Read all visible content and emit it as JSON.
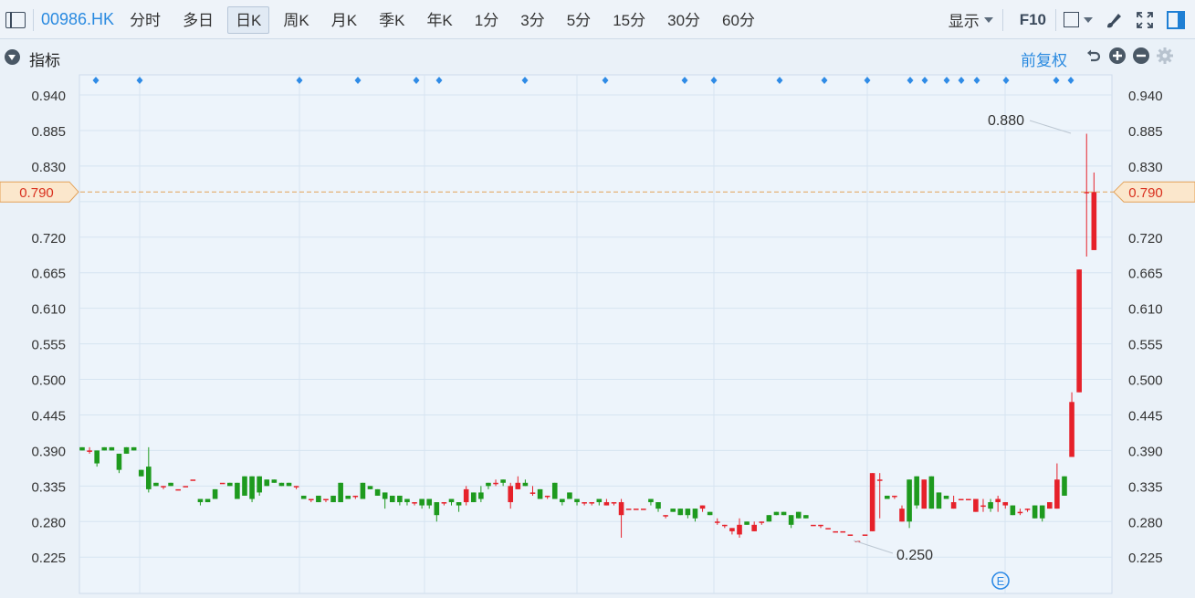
{
  "toolbar": {
    "symbol": "00986.HK",
    "periods": [
      "分时",
      "多日",
      "日K",
      "周K",
      "月K",
      "季K",
      "年K",
      "1分",
      "3分",
      "5分",
      "15分",
      "30分",
      "60分"
    ],
    "active_period": "日K",
    "display_label": "显示",
    "f10_label": "F10"
  },
  "indicator": {
    "title": "指标",
    "adjust_label": "前复权"
  },
  "icons": [
    "sidebar-toggle-icon",
    "square-icon",
    "brush-icon",
    "expand-icon",
    "panel-icon",
    "undo-icon",
    "plus-circle-icon",
    "minus-circle-icon",
    "gear-icon",
    "event-e-icon"
  ],
  "colors": {
    "up": "#e6212a",
    "down": "#1e9a1e",
    "price_line": "#e3a158",
    "price_text": "#d9301e",
    "marker": "#2f8be6",
    "grid": "#d6e4f1"
  },
  "chart_data": {
    "type": "candlestick",
    "ylim": [
      0.19,
      0.98
    ],
    "y_ticks": [
      0.94,
      0.885,
      0.83,
      0.775,
      0.72,
      0.665,
      0.61,
      0.555,
      0.5,
      0.445,
      0.39,
      0.335,
      0.28,
      0.225
    ],
    "y_tick_labels": [
      "0.940",
      "0.885",
      "0.830",
      "",
      "0.720",
      "0.665",
      "0.610",
      "0.555",
      "0.500",
      "0.445",
      "0.390",
      "0.335",
      "0.280",
      "0.225"
    ],
    "current_price": 0.79,
    "current_price_label": "0.790",
    "max_label": "0.880",
    "min_label": "0.250",
    "event_label": "E",
    "candles": [
      [
        0.395,
        0.395,
        0.39,
        0.39
      ],
      [
        0.39,
        0.395,
        0.385,
        0.39
      ],
      [
        0.39,
        0.39,
        0.365,
        0.37
      ],
      [
        0.395,
        0.395,
        0.39,
        0.39
      ],
      [
        0.395,
        0.395,
        0.39,
        0.39
      ],
      [
        0.385,
        0.385,
        0.355,
        0.36
      ],
      [
        0.395,
        0.395,
        0.385,
        0.385
      ],
      [
        0.395,
        0.395,
        0.39,
        0.39
      ],
      [
        0.36,
        0.36,
        0.35,
        0.35
      ],
      [
        0.365,
        0.395,
        0.325,
        0.33
      ],
      [
        0.34,
        0.34,
        0.335,
        0.335
      ],
      [
        0.335,
        0.335,
        0.33,
        0.335
      ],
      [
        0.34,
        0.34,
        0.335,
        0.335
      ],
      [
        0.33,
        0.33,
        0.33,
        0.33
      ],
      [
        0.335,
        0.335,
        0.335,
        0.335
      ],
      [
        0.345,
        0.345,
        0.345,
        0.345
      ],
      [
        0.315,
        0.315,
        0.305,
        0.31
      ],
      [
        0.315,
        0.315,
        0.31,
        0.31
      ],
      [
        0.33,
        0.33,
        0.315,
        0.315
      ],
      [
        0.34,
        0.34,
        0.34,
        0.34
      ],
      [
        0.34,
        0.34,
        0.335,
        0.335
      ],
      [
        0.34,
        0.34,
        0.315,
        0.315
      ],
      [
        0.35,
        0.35,
        0.32,
        0.32
      ],
      [
        0.35,
        0.35,
        0.31,
        0.315
      ],
      [
        0.35,
        0.35,
        0.32,
        0.325
      ],
      [
        0.345,
        0.345,
        0.335,
        0.335
      ],
      [
        0.345,
        0.345,
        0.34,
        0.34
      ],
      [
        0.34,
        0.34,
        0.335,
        0.335
      ],
      [
        0.34,
        0.34,
        0.335,
        0.335
      ],
      [
        0.335,
        0.335,
        0.33,
        0.335
      ],
      [
        0.32,
        0.32,
        0.315,
        0.315
      ],
      [
        0.315,
        0.315,
        0.31,
        0.315
      ],
      [
        0.32,
        0.32,
        0.31,
        0.31
      ],
      [
        0.315,
        0.315,
        0.31,
        0.315
      ],
      [
        0.32,
        0.32,
        0.31,
        0.31
      ],
      [
        0.34,
        0.34,
        0.31,
        0.31
      ],
      [
        0.32,
        0.32,
        0.315,
        0.315
      ],
      [
        0.32,
        0.32,
        0.315,
        0.32
      ],
      [
        0.34,
        0.34,
        0.315,
        0.315
      ],
      [
        0.335,
        0.335,
        0.33,
        0.33
      ],
      [
        0.33,
        0.33,
        0.32,
        0.32
      ],
      [
        0.325,
        0.325,
        0.3,
        0.315
      ],
      [
        0.32,
        0.32,
        0.31,
        0.31
      ],
      [
        0.32,
        0.32,
        0.305,
        0.31
      ],
      [
        0.315,
        0.315,
        0.305,
        0.31
      ],
      [
        0.31,
        0.31,
        0.305,
        0.31
      ],
      [
        0.315,
        0.315,
        0.3,
        0.305
      ],
      [
        0.315,
        0.315,
        0.3,
        0.305
      ],
      [
        0.31,
        0.31,
        0.28,
        0.29
      ],
      [
        0.31,
        0.31,
        0.305,
        0.31
      ],
      [
        0.315,
        0.315,
        0.305,
        0.31
      ],
      [
        0.31,
        0.31,
        0.295,
        0.305
      ],
      [
        0.31,
        0.335,
        0.305,
        0.33
      ],
      [
        0.325,
        0.325,
        0.31,
        0.31
      ],
      [
        0.325,
        0.335,
        0.31,
        0.315
      ],
      [
        0.34,
        0.34,
        0.33,
        0.335
      ],
      [
        0.34,
        0.345,
        0.335,
        0.34
      ],
      [
        0.345,
        0.345,
        0.335,
        0.34
      ],
      [
        0.31,
        0.34,
        0.3,
        0.335
      ],
      [
        0.33,
        0.35,
        0.33,
        0.34
      ],
      [
        0.34,
        0.345,
        0.335,
        0.335
      ],
      [
        0.325,
        0.335,
        0.32,
        0.325
      ],
      [
        0.33,
        0.33,
        0.315,
        0.315
      ],
      [
        0.32,
        0.32,
        0.315,
        0.32
      ],
      [
        0.34,
        0.34,
        0.315,
        0.315
      ],
      [
        0.315,
        0.315,
        0.305,
        0.31
      ],
      [
        0.325,
        0.325,
        0.315,
        0.315
      ],
      [
        0.315,
        0.315,
        0.305,
        0.31
      ],
      [
        0.31,
        0.31,
        0.305,
        0.31
      ],
      [
        0.31,
        0.31,
        0.305,
        0.31
      ],
      [
        0.315,
        0.315,
        0.305,
        0.31
      ],
      [
        0.305,
        0.315,
        0.305,
        0.31
      ],
      [
        0.31,
        0.31,
        0.305,
        0.31
      ],
      [
        0.29,
        0.315,
        0.255,
        0.31
      ],
      [
        0.3,
        0.3,
        0.3,
        0.3
      ],
      [
        0.3,
        0.3,
        0.3,
        0.3
      ],
      [
        0.3,
        0.3,
        0.3,
        0.3
      ],
      [
        0.315,
        0.315,
        0.305,
        0.31
      ],
      [
        0.31,
        0.31,
        0.295,
        0.3
      ],
      [
        0.29,
        0.29,
        0.285,
        0.29
      ],
      [
        0.3,
        0.3,
        0.295,
        0.295
      ],
      [
        0.3,
        0.3,
        0.29,
        0.29
      ],
      [
        0.3,
        0.3,
        0.285,
        0.29
      ],
      [
        0.3,
        0.3,
        0.28,
        0.285
      ],
      [
        0.3,
        0.305,
        0.295,
        0.305
      ],
      [
        0.295,
        0.295,
        0.29,
        0.29
      ],
      [
        0.28,
        0.285,
        0.275,
        0.28
      ],
      [
        0.275,
        0.275,
        0.27,
        0.275
      ],
      [
        0.265,
        0.27,
        0.26,
        0.27
      ],
      [
        0.26,
        0.285,
        0.255,
        0.275
      ],
      [
        0.28,
        0.28,
        0.275,
        0.275
      ],
      [
        0.265,
        0.28,
        0.265,
        0.275
      ],
      [
        0.28,
        0.28,
        0.275,
        0.28
      ],
      [
        0.29,
        0.29,
        0.28,
        0.28
      ],
      [
        0.295,
        0.295,
        0.29,
        0.29
      ],
      [
        0.295,
        0.295,
        0.29,
        0.29
      ],
      [
        0.29,
        0.29,
        0.27,
        0.275
      ],
      [
        0.295,
        0.295,
        0.285,
        0.285
      ],
      [
        0.29,
        0.29,
        0.285,
        0.285
      ],
      [
        0.275,
        0.275,
        0.275,
        0.275
      ],
      [
        0.275,
        0.275,
        0.27,
        0.275
      ],
      [
        0.27,
        0.27,
        0.27,
        0.27
      ],
      [
        0.265,
        0.265,
        0.265,
        0.265
      ],
      [
        0.265,
        0.265,
        0.265,
        0.265
      ],
      [
        0.26,
        0.26,
        0.26,
        0.26
      ],
      [
        0.25,
        0.25,
        0.25,
        0.25
      ],
      [
        0.26,
        0.26,
        0.26,
        0.26
      ],
      [
        0.265,
        0.355,
        0.265,
        0.355
      ],
      [
        0.345,
        0.355,
        0.285,
        0.345
      ],
      [
        0.32,
        0.32,
        0.315,
        0.315
      ],
      [
        0.32,
        0.32,
        0.315,
        0.32
      ],
      [
        0.28,
        0.305,
        0.28,
        0.3
      ],
      [
        0.345,
        0.345,
        0.27,
        0.28
      ],
      [
        0.35,
        0.35,
        0.3,
        0.305
      ],
      [
        0.3,
        0.345,
        0.3,
        0.345
      ],
      [
        0.35,
        0.35,
        0.3,
        0.3
      ],
      [
        0.325,
        0.325,
        0.3,
        0.3
      ],
      [
        0.32,
        0.32,
        0.315,
        0.315
      ],
      [
        0.3,
        0.32,
        0.3,
        0.31
      ],
      [
        0.315,
        0.315,
        0.315,
        0.315
      ],
      [
        0.315,
        0.315,
        0.315,
        0.315
      ],
      [
        0.295,
        0.315,
        0.295,
        0.315
      ],
      [
        0.305,
        0.315,
        0.295,
        0.305
      ],
      [
        0.31,
        0.315,
        0.295,
        0.3
      ],
      [
        0.31,
        0.32,
        0.295,
        0.315
      ],
      [
        0.305,
        0.31,
        0.3,
        0.31
      ],
      [
        0.305,
        0.305,
        0.29,
        0.29
      ],
      [
        0.295,
        0.3,
        0.29,
        0.295
      ],
      [
        0.3,
        0.3,
        0.295,
        0.3
      ],
      [
        0.305,
        0.305,
        0.285,
        0.285
      ],
      [
        0.305,
        0.305,
        0.28,
        0.285
      ],
      [
        0.3,
        0.31,
        0.3,
        0.31
      ],
      [
        0.3,
        0.37,
        0.3,
        0.345
      ],
      [
        0.35,
        0.35,
        0.32,
        0.32
      ],
      [
        0.38,
        0.48,
        0.38,
        0.465
      ],
      [
        0.48,
        0.67,
        0.48,
        0.67
      ],
      [
        0.79,
        0.88,
        0.69,
        0.79
      ],
      [
        0.7,
        0.82,
        0.7,
        0.79
      ]
    ],
    "markers": [
      105,
      153,
      328,
      392,
      456,
      481,
      575,
      663,
      750,
      782,
      854,
      903,
      950,
      997,
      1013,
      1037,
      1053,
      1070,
      1102,
      1157,
      1173
    ]
  }
}
